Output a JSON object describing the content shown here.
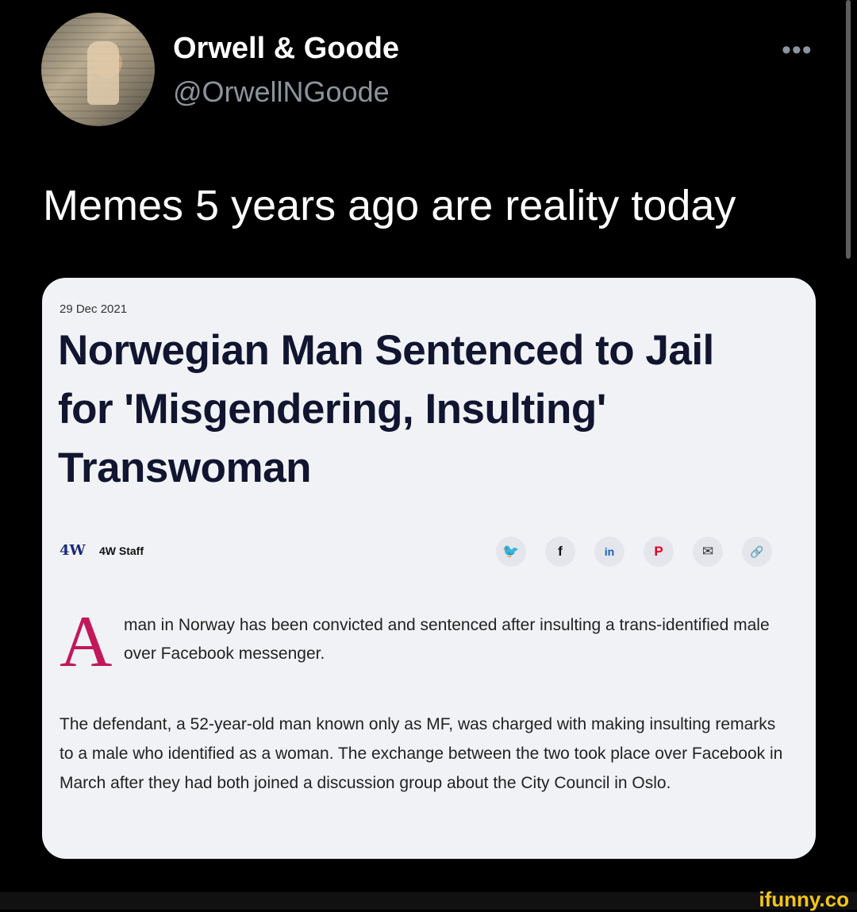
{
  "tweet": {
    "display_name": "Orwell & Goode",
    "handle": "@OrwellNGoode",
    "more_icon": "•••",
    "text": "Memes 5 years ago are reality today"
  },
  "article": {
    "date": "29 Dec 2021",
    "headline": "Norwegian Man Sentenced to Jail for 'Misgendering, Insulting' Transwoman",
    "logo": "4W",
    "author": "4W Staff",
    "share_icons": [
      "twitter-icon",
      "facebook-icon",
      "linkedin-icon",
      "pinterest-icon",
      "email-icon",
      "link-icon"
    ],
    "share_glyphs": {
      "twitter": "🐦",
      "facebook": "f",
      "linkedin": "in",
      "pinterest": "P",
      "email": "✉",
      "link": "🔗"
    },
    "drop_cap": "A",
    "lead_rest": "man in Norway has been convicted and sentenced after insulting a trans-identified male over Facebook messenger.",
    "body": "The defendant, a 52-year-old man known only as MF, was charged with making insulting remarks to a male who identified as a woman. The exchange between the two took place over Facebook in March after they had both joined a discussion group about the City Council in Oslo."
  },
  "watermark": "ifunny.co",
  "colors": {
    "background": "#000000",
    "card": "#f1f2f5",
    "dropcap": "#c2185b",
    "watermark": "#f5c518",
    "pinterest": "#e60023",
    "twitter": "#1d9bf0"
  }
}
